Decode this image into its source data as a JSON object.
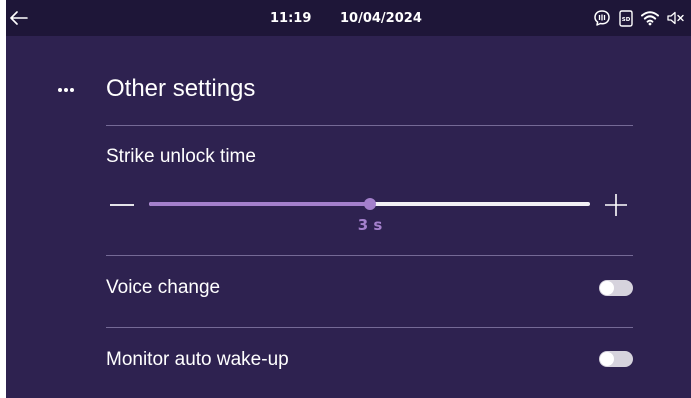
{
  "status_bar": {
    "time": "11:19",
    "date": "10/04/2024",
    "icons": [
      "back-arrow-icon",
      "intercom-icon",
      "sd-card-icon",
      "wifi-icon",
      "speaker-muted-icon"
    ]
  },
  "section": {
    "title": "Other settings",
    "menu_icon": "more-dots-icon"
  },
  "settings": {
    "strike_unlock": {
      "label": "Strike unlock time",
      "value_text": "3 s",
      "level_fraction": 0.5
    },
    "voice_change": {
      "label": "Voice change",
      "enabled": false
    },
    "monitor_wake": {
      "label": "Monitor auto wake-up",
      "enabled": false
    }
  },
  "colors": {
    "background": "#2e2250",
    "status_bar": "#1e1638",
    "accent": "#a480cc",
    "divider": "#756a96",
    "toggle_off": "#d6d3dd"
  }
}
